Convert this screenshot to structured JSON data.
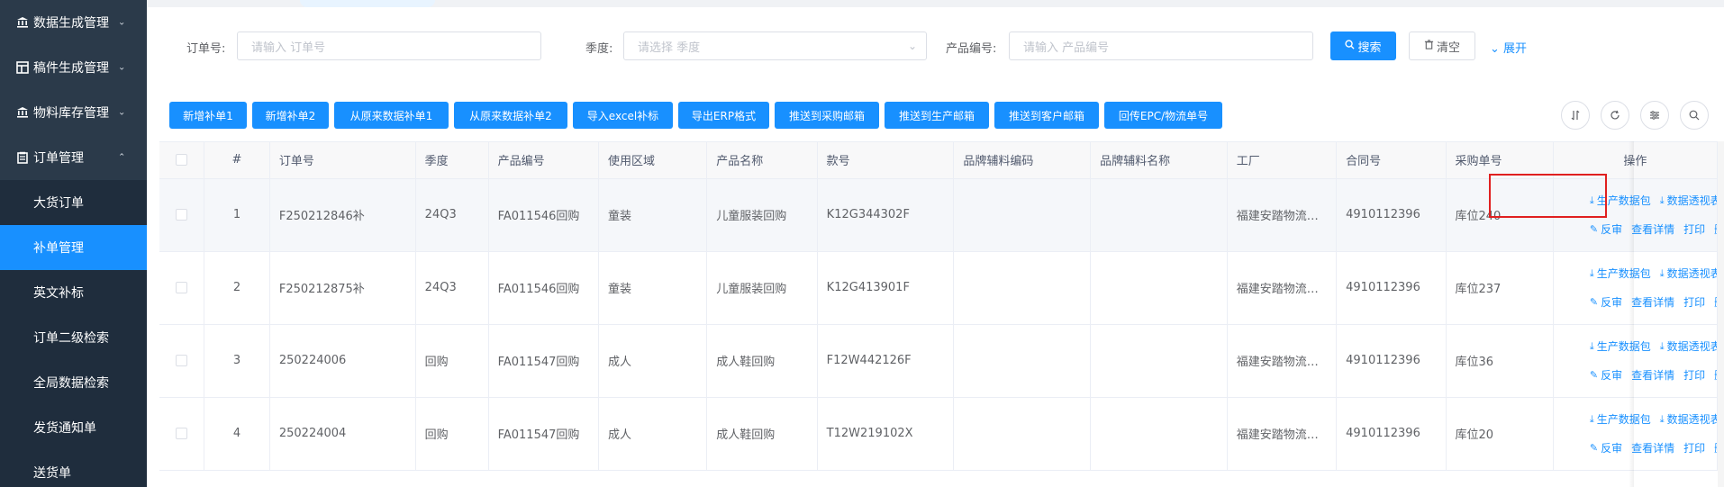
{
  "sidebar": {
    "groups": [
      {
        "label": "数据生成管理",
        "icon": "bank-icon"
      },
      {
        "label": "稿件生成管理",
        "icon": "layout-icon"
      },
      {
        "label": "物料库存管理",
        "icon": "bank-icon"
      },
      {
        "label": "订单管理",
        "icon": "clipboard-icon"
      }
    ],
    "sub_items": [
      {
        "label": "大货订单",
        "active": false
      },
      {
        "label": "补单管理",
        "active": true
      },
      {
        "label": "英文补标",
        "active": false
      },
      {
        "label": "订单二级检索",
        "active": false
      },
      {
        "label": "全局数据检索",
        "active": false
      },
      {
        "label": "发货通知单",
        "active": false
      },
      {
        "label": "送货单",
        "active": false
      }
    ],
    "active_color": "#1890ff"
  },
  "search": {
    "order_label": "订单号:",
    "order_placeholder": "请输入 订单号",
    "season_label": "季度:",
    "season_placeholder": "请选择 季度",
    "product_label": "产品编号:",
    "product_placeholder": "请输入 产品编号",
    "search_button": "搜索",
    "clear_button": "清空",
    "expand_link": "展开"
  },
  "toolbar": {
    "buttons": [
      "新增补单1",
      "新增补单2",
      "从原来数据补单1",
      "从原来数据补单2",
      "导入excel补标",
      "导出ERP格式",
      "推送到采购邮箱",
      "推送到生产邮箱",
      "推送到客户邮箱",
      "回传EPC/物流单号"
    ],
    "primary_color": "#1890ff"
  },
  "table": {
    "headers": {
      "index": "#",
      "order_no": "订单号",
      "season": "季度",
      "product_no": "产品编号",
      "area": "使用区域",
      "product_name": "产品名称",
      "style_no": "款号",
      "brand_code": "品牌辅料编码",
      "brand_name": "品牌辅料名称",
      "factory": "工厂",
      "contract_no": "合同号",
      "purchase_no": "采购单号",
      "ops": "操作"
    },
    "rows": [
      {
        "index": "1",
        "order_no": "F250212846补",
        "season": "24Q3",
        "product_no": "FA011546回购",
        "area": "童装",
        "product_name": "儿童服装回购",
        "style_no": "K12G344302F",
        "brand_code": "",
        "brand_name": "",
        "factory": "福建安踏物流…",
        "contract_no": "4910112396",
        "purchase_no": "库位240"
      },
      {
        "index": "2",
        "order_no": "F250212875补",
        "season": "24Q3",
        "product_no": "FA011546回购",
        "area": "童装",
        "product_name": "儿童服装回购",
        "style_no": "K12G413901F",
        "brand_code": "",
        "brand_name": "",
        "factory": "福建安踏物流…",
        "contract_no": "4910112396",
        "purchase_no": "库位237"
      },
      {
        "index": "3",
        "order_no": "250224006",
        "season": "回购",
        "product_no": "FA011547回购",
        "area": "成人",
        "product_name": "成人鞋回购",
        "style_no": "F12W442126F",
        "brand_code": "",
        "brand_name": "",
        "factory": "福建安踏物流…",
        "contract_no": "4910112396",
        "purchase_no": "库位36"
      },
      {
        "index": "4",
        "order_no": "250224004",
        "season": "回购",
        "product_no": "FA011547回购",
        "area": "成人",
        "product_name": "成人鞋回购",
        "style_no": "T12W219102X",
        "brand_code": "",
        "brand_name": "",
        "factory": "福建安踏物流…",
        "contract_no": "4910112396",
        "purchase_no": "库位20"
      }
    ],
    "row_ops": {
      "production_package": "生产数据包",
      "data_pivot": "数据透视表",
      "reverse_review": "反审",
      "view_detail": "查看详情",
      "print": "打印",
      "delete": "删除"
    }
  },
  "highlight_color": "#e02020"
}
